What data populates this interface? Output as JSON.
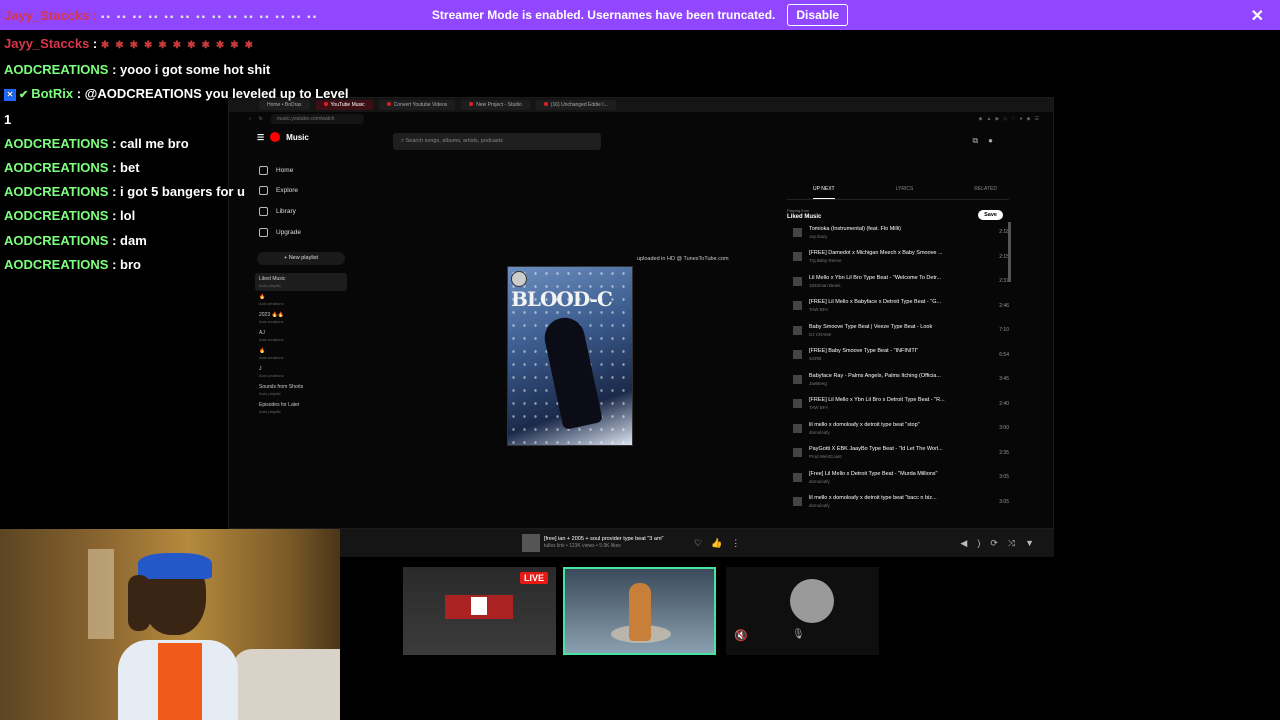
{
  "banner": {
    "partial_user": "Jayy_Staccks",
    "message": "Streamer Mode is enabled. Usernames have been truncated.",
    "disable_label": "Disable",
    "close_glyph": "✕"
  },
  "chat": {
    "lines": [
      {
        "user": "Jayy_Staccks",
        "text": ""
      },
      {
        "user": "AODCREATIONS",
        "text": " : yooo i got some hot shit"
      },
      {
        "user": "BotRix",
        "text": " : @AODCREATIONS you leveled up to Level"
      },
      {
        "user": "",
        "text": "1"
      },
      {
        "user": "AODCREATIONS",
        "text": " : call me bro"
      },
      {
        "user": "AODCREATIONS",
        "text": " : bet"
      },
      {
        "user": "AODCREATIONS",
        "text": " : i got 5 bangers for u"
      },
      {
        "user": "AODCREATIONS",
        "text": " : lol"
      },
      {
        "user": "AODCREATIONS",
        "text": " : dam"
      },
      {
        "user": "AODCREATIONS",
        "text": " : bro"
      }
    ]
  },
  "capture": {
    "tabs": [
      "Home • BoDrax",
      "YouTube Music",
      "Convert Youtube Videos",
      "New Project - Studio",
      "(16) Unchanged Eddie I..."
    ],
    "url": "music.youtube.com/watch",
    "app_name": "Music",
    "search_placeholder": "Search songs, albums, artists, podcasts",
    "nav": [
      "Home",
      "Explore",
      "Library",
      "Upgrade"
    ],
    "new_playlist": "+ New playlist",
    "playlists": [
      {
        "name": "Liked Music",
        "sub": "Auto playlist"
      },
      {
        "name": "🔥",
        "sub": "Aod creations"
      },
      {
        "name": "2023 🔥🔥",
        "sub": "Aod creations"
      },
      {
        "name": "AJ",
        "sub": "Aod creations"
      },
      {
        "name": "🔥",
        "sub": "Aod creations"
      },
      {
        "name": "J",
        "sub": "Aod creations"
      },
      {
        "name": "Sounds from Shorts",
        "sub": "Auto playlist"
      },
      {
        "name": "Episodes for Later",
        "sub": "Auto playlist"
      }
    ],
    "album_title": "BLOOD-C",
    "uploaded_text": "uploaded in HD @ TunesToTube.com",
    "queue_tabs": [
      "UP NEXT",
      "LYRICS",
      "RELATED"
    ],
    "playing_from": "Playing from",
    "playing_from_name": "Liked Music",
    "save_label": "Save",
    "queue": [
      {
        "title": "Tomioka (Instrumental) (feat. Flo Milli)",
        "artist": "Jay Eazy",
        "dur": "2:18"
      },
      {
        "title": "[FREE] Damedot x Michigan Meech x Baby Smoove ...",
        "artist": "Trg Baby Reece",
        "dur": "2:15"
      },
      {
        "title": "Lil Mello x Ybn Lil Bro Type Beat - \"Welcome To Detr...",
        "artist": "1832man Beats",
        "dur": "2:37"
      },
      {
        "title": "[FREE] Lil Mello x Babyface x Detroit Type Beat - \"G...",
        "artist": "TAW BFA",
        "dur": "2:46"
      },
      {
        "title": "Baby Smoove Type Beat | Veeze Type Beat - Look",
        "artist": "DJ CRANK",
        "dur": "7:10"
      },
      {
        "title": "[FREE] Baby Smoove Type Beat - \"INFINITI\"",
        "artist": "SSRB",
        "dur": "6:54"
      },
      {
        "title": "Babyface Ray - Palms Angels, Palms Itching (Officia...",
        "artist": "JaeBeeg",
        "dur": "3:45"
      },
      {
        "title": "[FREE] Lil Mello x Ybn Lil Bro x Detroit Type Beat - \"R...",
        "artist": "TAW BFA",
        "dur": "2:40"
      },
      {
        "title": "lil mello x domoloafy x detroit type beat \"stop\"",
        "artist": "domoloafy",
        "dur": "3:00"
      },
      {
        "title": "PayGotti X EBK JaayBo Type Beat - \"Id Let The Worl...",
        "artist": "Prod.WestCoast",
        "dur": "2:35"
      },
      {
        "title": "[Free] Lil Mello x Detroit Type Beat - \"Murda Millions\"",
        "artist": "domoloafy",
        "dur": "3:05"
      },
      {
        "title": "lil mello x domoloafy x detroit type beat \"bacc n biz...",
        "artist": "domoloafy",
        "dur": "3:05"
      }
    ],
    "now_playing_title": "[free] ian + 2005 + soul provider type beat \"3 am\"",
    "now_playing_sub": "tulles link • 123K views • 5.9K likes"
  },
  "cards": {
    "live_label": "LIVE"
  },
  "colors": {
    "banner": "#9147ff",
    "chat_user": "#7dff7d",
    "selected_card": "#45e4a1"
  }
}
